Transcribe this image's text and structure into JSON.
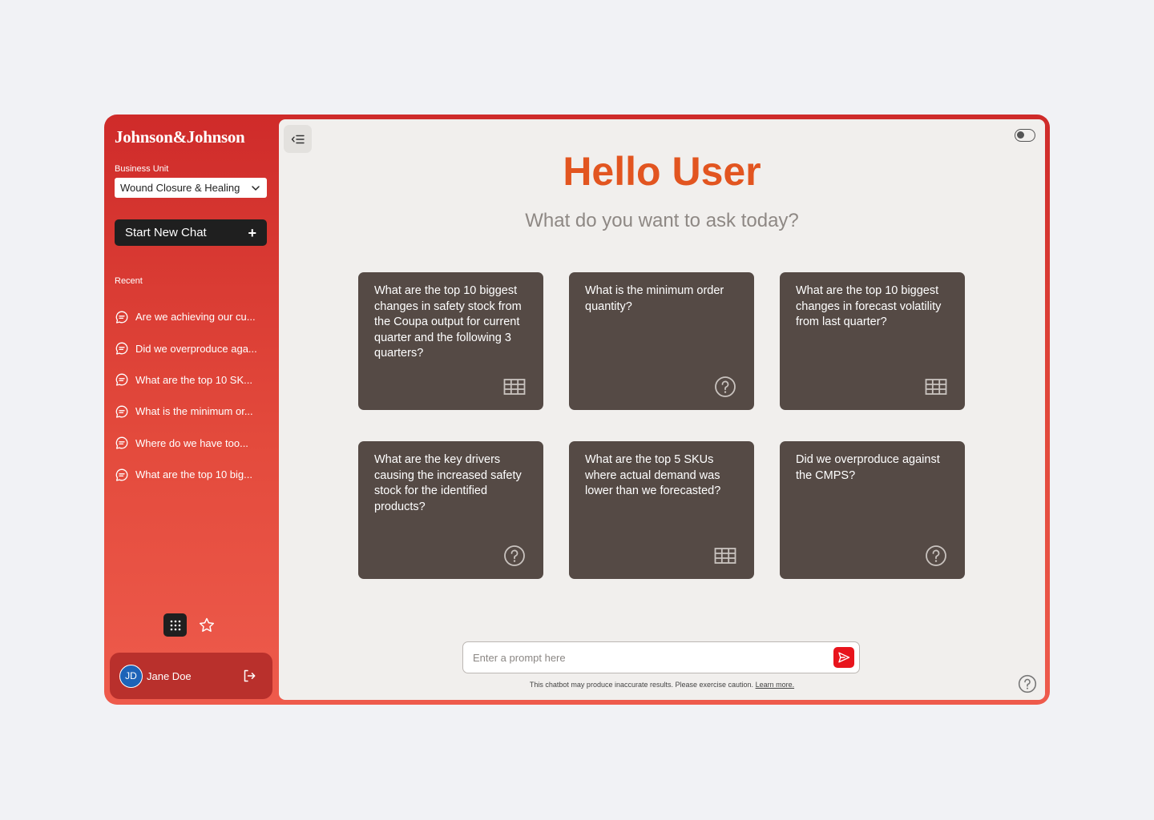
{
  "brand": {
    "logo_text": "Johnson&Johnson"
  },
  "sidebar": {
    "business_unit_label": "Business Unit",
    "business_unit_value": "Wound Closure & Healing",
    "new_chat_label": "Start New Chat",
    "new_chat_icon": "+",
    "recent_label": "Recent",
    "recent": [
      "Are we achieving our cu...",
      "Did we overproduce aga...",
      "What are the top 10 SK...",
      "What is the minimum or...",
      "Where do we have too...",
      "What are the top 10 big..."
    ]
  },
  "user": {
    "initials": "JD",
    "name": "Jane Doe"
  },
  "main": {
    "greeting": "Hello User",
    "subtitle": "What do you want to ask today?",
    "cards": [
      {
        "text": "What are the top 10 biggest changes in safety stock from the Coupa output for current quarter and the following 3 quarters?",
        "icon": "table-icon"
      },
      {
        "text": "What is the minimum order quantity?",
        "icon": "question-icon"
      },
      {
        "text": "What are the top 10 biggest changes in forecast volatility from last quarter?",
        "icon": "table-icon"
      },
      {
        "text": "What are the key drivers causing the increased safety stock for the identified products?",
        "icon": "question-icon"
      },
      {
        "text": "What are the top 5 SKUs where actual demand was lower than we forecasted?",
        "icon": "table-icon"
      },
      {
        "text": "Did we overproduce against the CMPS?",
        "icon": "question-icon"
      }
    ],
    "prompt_placeholder": "Enter a prompt here",
    "disclaimer_text": "This chatbot may produce inaccurate results. Please exercise caution.",
    "disclaimer_link": "Learn more."
  },
  "colors": {
    "sidebar_top": "#cf2b2a",
    "sidebar_bottom": "#ee5b4c",
    "greeting": "#e25520",
    "card_bg": "#554a45",
    "send_button": "#e8141c"
  }
}
